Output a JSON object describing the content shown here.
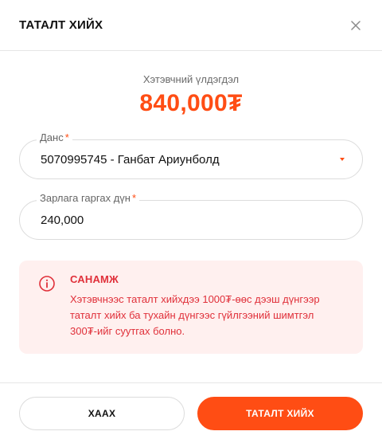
{
  "header": {
    "title": "ТАТАЛТ ХИЙХ",
    "close_icon": "close-icon"
  },
  "balance": {
    "label": "Хэтэвчний үлдэгдэл",
    "amount": "840,000₮"
  },
  "account_field": {
    "label": "Данс",
    "required_mark": "*",
    "value": "5070995745 - Ганбат Ариунболд"
  },
  "amount_field": {
    "label": "Зарлага гаргах дүн",
    "required_mark": "*",
    "value": "240,000"
  },
  "alert": {
    "title": "САНАМЖ",
    "lines": [
      "Хэтэвчнээс таталт хийхдээ 1000₮-өөс дээш дүнгээр",
      "таталт хийх ба тухайн дүнгээс гүйлгээний шимтгэл",
      "300₮-ийг суутгах болно."
    ]
  },
  "footer": {
    "cancel_label": "ХААХ",
    "submit_label": "ТАТАЛТ ХИЙХ"
  },
  "colors": {
    "accent": "#ff4d14",
    "alert_text": "#e0303a",
    "alert_bg": "#fff0ef"
  }
}
